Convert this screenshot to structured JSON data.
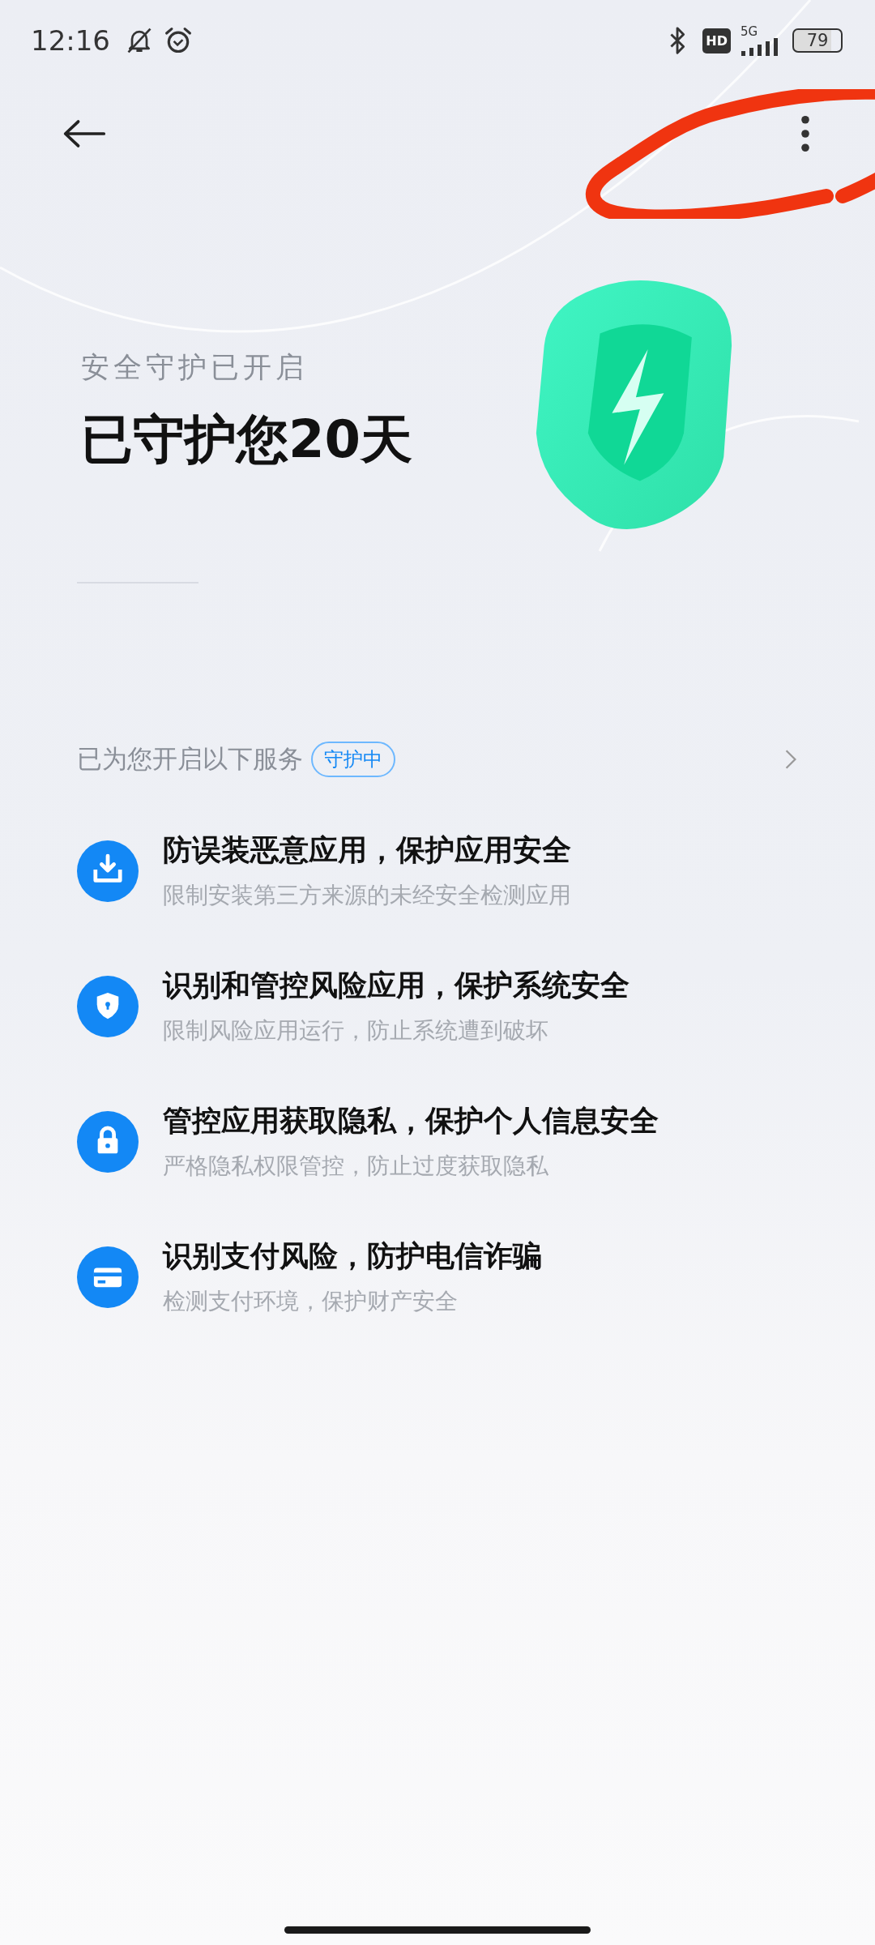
{
  "status_bar": {
    "time": "12:16",
    "network_badge": "HD",
    "network_type": "5G",
    "battery": "79"
  },
  "header": {
    "subtitle": "安全守护已开启",
    "title": "已守护您20天"
  },
  "services": {
    "heading": "已为您开启以下服务",
    "badge": "守护中",
    "items": [
      {
        "kind": "download",
        "title": "防误装恶意应用，保护应用安全",
        "description": "限制安装第三方来源的未经安全检测应用"
      },
      {
        "kind": "shield",
        "title": "识别和管控风险应用，保护系统安全",
        "description": "限制风险应用运行，防止系统遭到破坏"
      },
      {
        "kind": "lock",
        "title": "管控应用获取隐私，保护个人信息安全",
        "description": "严格隐私权限管控，防止过度获取隐私"
      },
      {
        "kind": "card",
        "title": "识别支付风险，防护电信诈骗",
        "description": "检测支付环境，保护财产安全"
      }
    ]
  }
}
